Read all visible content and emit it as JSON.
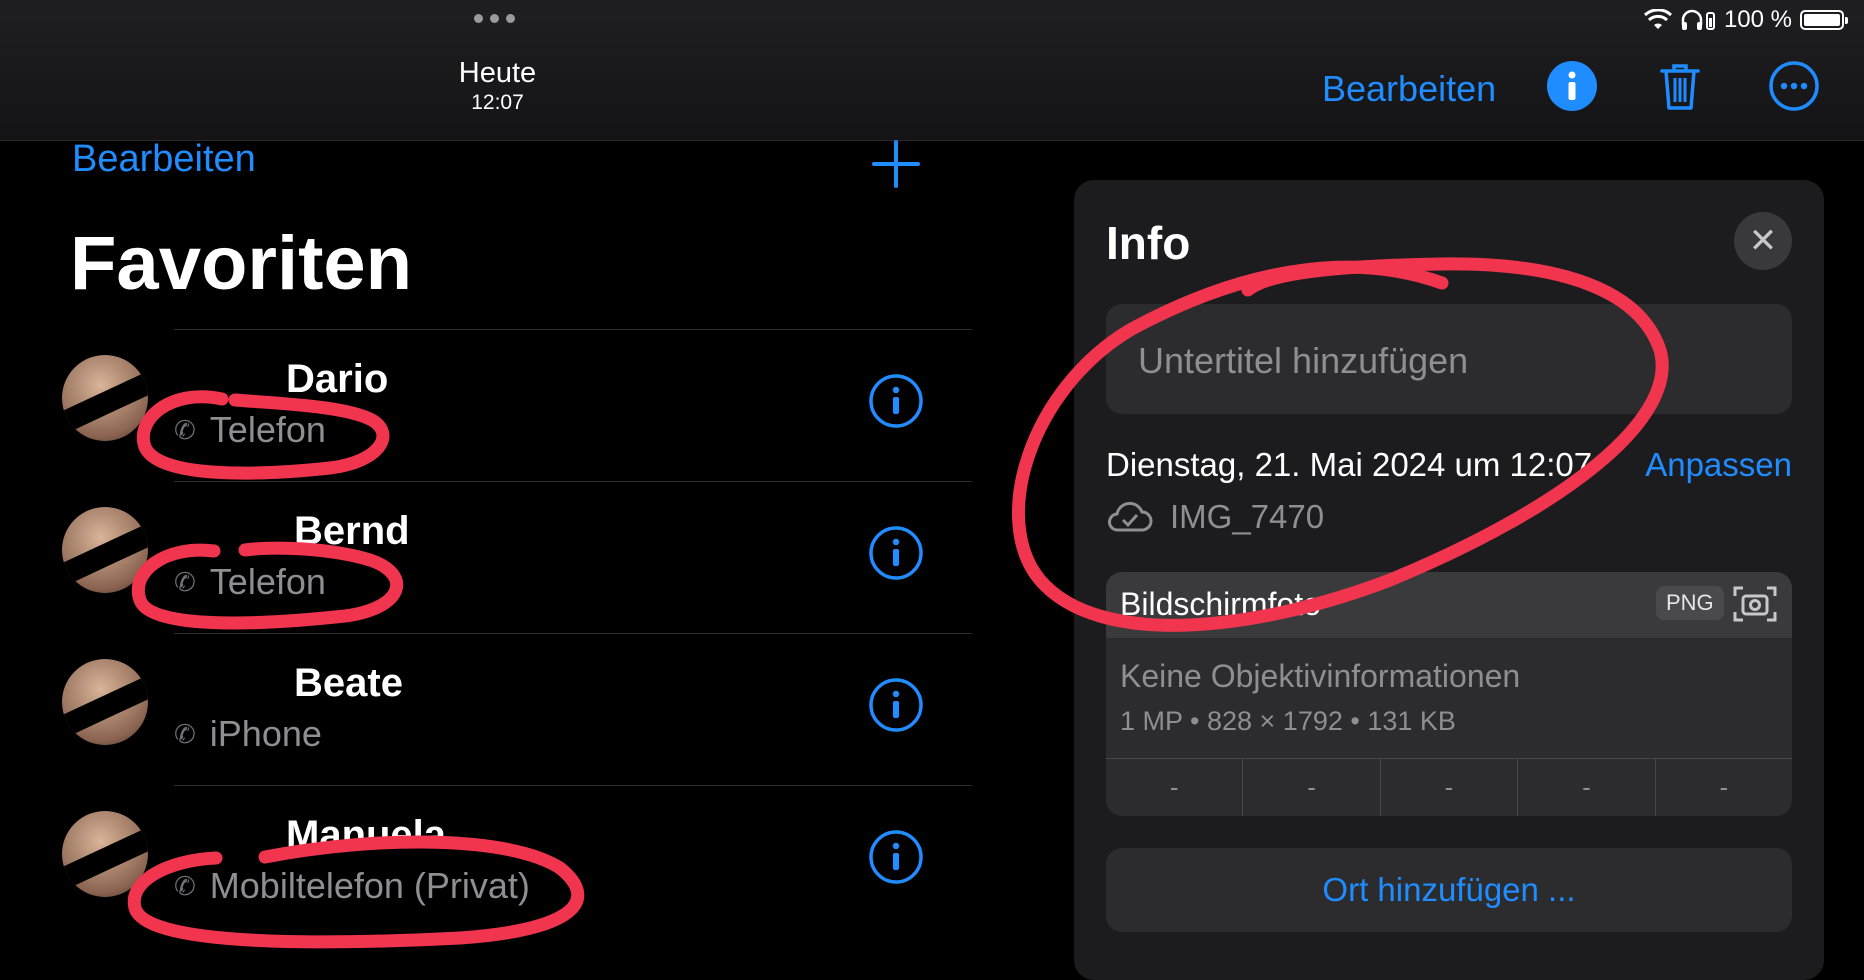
{
  "top": {
    "title": "Heute",
    "time": "12:07",
    "battery": "100 %",
    "edit_label": "Bearbeiten"
  },
  "favorites": {
    "edit_label": "Bearbeiten",
    "title": "Favoriten",
    "contacts": [
      {
        "name": "Dario",
        "label": "Telefon"
      },
      {
        "name": "Bernd",
        "label": "Telefon"
      },
      {
        "name": "Beate",
        "label": "iPhone"
      },
      {
        "name": "Manuela",
        "label": "Mobiltelefon (Privat)"
      }
    ]
  },
  "info_panel": {
    "title": "Info",
    "caption_placeholder": "Untertitel hinzufügen",
    "date": "Dienstag, 21. Mai 2024 um 12:07",
    "adjust_label": "Anpassen",
    "filename": "IMG_7470",
    "kind": "Bildschirmfoto",
    "format_badge": "PNG",
    "lens": "Keine Objektivinformationen",
    "specs": "1 MP • 828 × 1792 • 131 KB",
    "exif": [
      "-",
      "-",
      "-",
      "-",
      "-"
    ],
    "add_place": "Ort hinzufügen ..."
  },
  "colors": {
    "accent": "#1f8cff",
    "annotation": "#f2354f",
    "panel": "#1c1c1e"
  },
  "icons": [
    "wifi-icon",
    "headphones-icon",
    "battery-icon",
    "info-icon",
    "trash-icon",
    "more-icon",
    "plus-icon",
    "phone-icon",
    "close-icon",
    "icloud-check-icon",
    "screenshot-icon"
  ]
}
